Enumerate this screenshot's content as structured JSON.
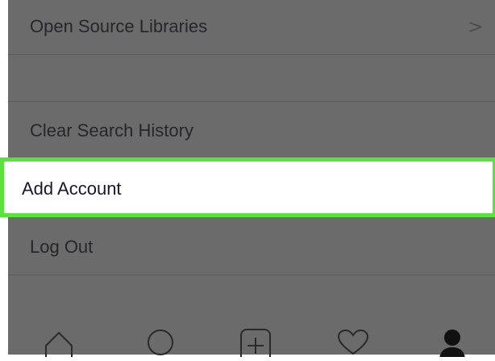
{
  "settings": {
    "items": [
      {
        "label": "Open Source Libraries",
        "chevron": ">"
      },
      {
        "label": ""
      },
      {
        "label": "Clear Search History"
      },
      {
        "label": "Add Account",
        "highlighted": true
      },
      {
        "label": "Log Out"
      }
    ]
  },
  "colors": {
    "overlay": "#6b6b6b",
    "highlight_border": "#58e43a",
    "highlight_bg": "#ffffff",
    "text": "#26262b"
  },
  "tabbar": {
    "icons": [
      "home-icon",
      "search-icon",
      "add-post-icon",
      "activity-heart-icon",
      "profile-icon"
    ]
  }
}
